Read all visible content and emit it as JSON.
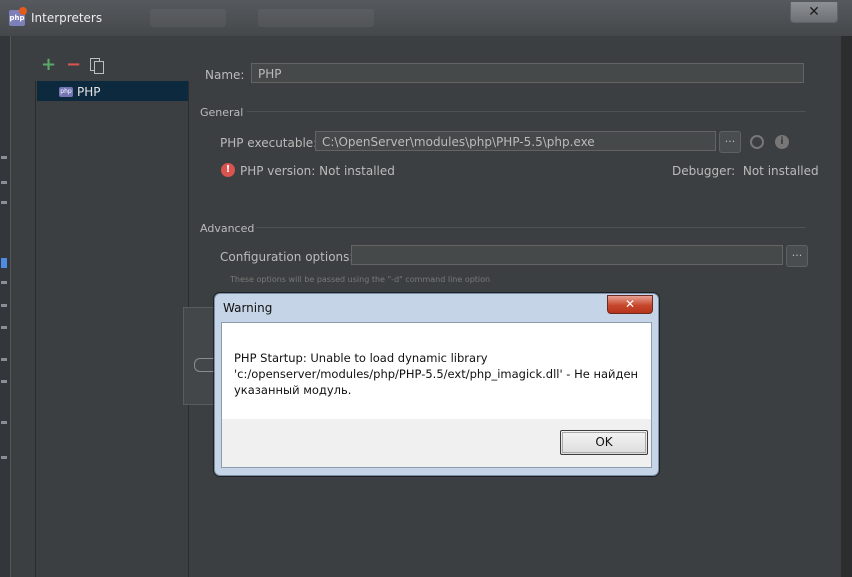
{
  "window": {
    "title": "Interpreters",
    "close_symbol": "✕",
    "ghost_tabs": [
      "",
      ""
    ]
  },
  "toolbar": {
    "add_symbol": "+",
    "remove_symbol": "−",
    "icons": [
      "add-icon",
      "remove-icon",
      "copy-icon"
    ]
  },
  "interpreter_list": {
    "items": [
      {
        "badge": "php",
        "label": "PHP",
        "selected": true
      }
    ]
  },
  "form": {
    "name_label": "Name:",
    "name_value": "PHP",
    "general_header": "General",
    "executable_label": "PHP executable:",
    "executable_value": "C:\\OpenServer\\modules\\php\\PHP-5.5\\php.exe",
    "browse_symbol": "...",
    "version_text": "PHP version: Not installed",
    "debugger_text": "Debugger:  Not installed",
    "advanced_header": "Advanced",
    "config_label": "Configuration options:",
    "config_value": "",
    "config_hint": "These options will be passed using the \"-d\" command line option"
  },
  "warning_dialog": {
    "title": "Warning",
    "close_symbol": "✕",
    "message": "PHP Startup: Unable to load dynamic library 'c:/openserver/modules/php/PHP-5.5/ext/php_imagick.dll' - Не найден указанный модуль.",
    "ok_label": "OK"
  },
  "colors": {
    "dialog_bg": "#3c3f41",
    "selection": "#0d293e",
    "add_green": "#59a869",
    "remove_red": "#d9534f",
    "warning_frame": "#c5d4e6"
  }
}
